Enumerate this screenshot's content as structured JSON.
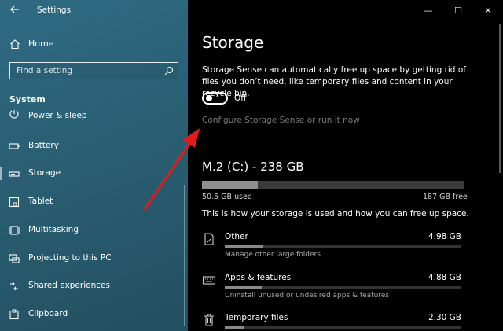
{
  "window": {
    "title": "Settings",
    "controls": {
      "minimize": "—",
      "maximize": "☐",
      "close": "✕"
    }
  },
  "sidebar": {
    "home_label": "Home",
    "search_placeholder": "Find a setting",
    "section_header": "System",
    "items": [
      {
        "label": "Power & sleep",
        "icon": "power-icon"
      },
      {
        "label": "Battery",
        "icon": "battery-icon"
      },
      {
        "label": "Storage",
        "icon": "storage-icon",
        "selected": true
      },
      {
        "label": "Tablet",
        "icon": "tablet-icon"
      },
      {
        "label": "Multitasking",
        "icon": "multitasking-icon"
      },
      {
        "label": "Projecting to this PC",
        "icon": "projecting-icon"
      },
      {
        "label": "Shared experiences",
        "icon": "shared-experiences-icon"
      },
      {
        "label": "Clipboard",
        "icon": "clipboard-icon"
      }
    ]
  },
  "main": {
    "title": "Storage",
    "description": "Storage Sense can automatically free up space by getting rid of files you don’t need, like temporary files and content in your recycle bin.",
    "toggle_state": "Off",
    "configure_link": "Configure Storage Sense or run it now",
    "drive": {
      "title": "M.2 (C:) - 238 GB",
      "used": "50.5 GB used",
      "free": "187 GB free",
      "used_fraction": 0.212
    },
    "info_text": "This is how your storage is used and how you can free up space.",
    "categories": [
      {
        "name": "Other",
        "size": "4.98 GB",
        "subtitle": "Manage other large folders",
        "fraction": 0.16,
        "icon": "document-icon"
      },
      {
        "name": "Apps & features",
        "size": "4.88 GB",
        "subtitle": "Uninstall unused or undesired apps & features",
        "fraction": 0.155,
        "icon": "keyboard-icon"
      },
      {
        "name": "Temporary files",
        "size": "2.30 GB",
        "subtitle": "",
        "fraction": 0.08,
        "icon": "trash-icon"
      }
    ]
  },
  "colors": {
    "sidebar_bg": "#2a5f73",
    "main_bg": "#000000",
    "accent_arrow": "#e31b1b",
    "link_gray": "#7a7a7a"
  }
}
